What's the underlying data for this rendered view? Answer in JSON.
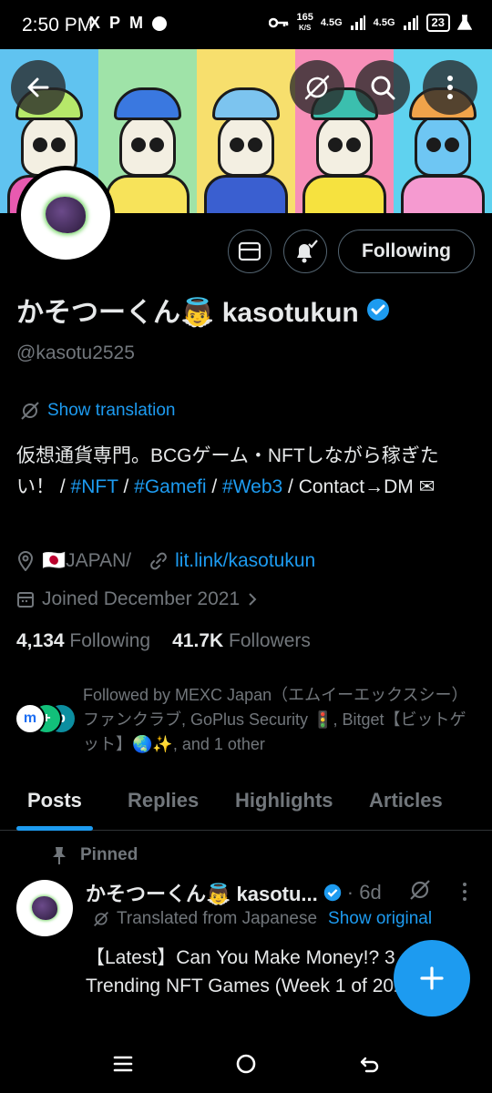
{
  "status_bar": {
    "time": "2:50 PM",
    "app_icons": [
      "X",
      "P",
      "M"
    ],
    "net_speed_value": "165",
    "net_speed_unit": "K/S",
    "network_1": "4.5G",
    "network_2": "4.5G",
    "battery": "23"
  },
  "banner": {
    "colors": [
      "#60c3f0",
      "#9fe3a8",
      "#f7df6d",
      "#f78fb8",
      "#5fd2ef"
    ]
  },
  "header_buttons": {
    "back_icon": "arrow-left-icon",
    "translate_icon": "translate-icon",
    "search_icon": "search-icon",
    "more_icon": "more-vertical-icon"
  },
  "profile": {
    "display_name": "かそつーくん👼 kasotukun",
    "handle": "@kasotu2525",
    "following_label": "Following",
    "show_translation": "Show translation",
    "bio_prefix": "仮想通貨専門。BCGゲーム・NFTしながら稼ぎたい！ / ",
    "bio_tag_1": "#NFT",
    "bio_sep_1": " / ",
    "bio_tag_2": "#Gamefi",
    "bio_sep_2": " / ",
    "bio_tag_3": "#Web3",
    "bio_suffix": " / Contact→DM ✉",
    "location": "🇯🇵JAPAN/",
    "link": "lit.link/kasotukun",
    "joined": "Joined December 2021",
    "following_count": "4,134",
    "following_text": "Following",
    "followers_count": "41.7K",
    "followers_text": "Followers",
    "followed_by": "Followed by MEXC Japan（エムイーエックスシー）ファンクラブ, GoPlus Security 🚦, Bitget【ビットゲット】🌏✨, and 1 other"
  },
  "tabs": [
    "Posts",
    "Replies",
    "Highlights",
    "Articles"
  ],
  "pinned_post": {
    "pinned_label": "Pinned",
    "author": "かそつーくん👼 kasotu...",
    "time": "· 6d",
    "translated_label": "Translated from Japanese",
    "show_original": "Show original",
    "text": "【Latest】Can You Make Money!? 3 Trending NFT Games (Week 1 of 2026)"
  },
  "colors": {
    "accent": "#1d9bf0",
    "muted": "#71767b",
    "background": "#000000"
  }
}
